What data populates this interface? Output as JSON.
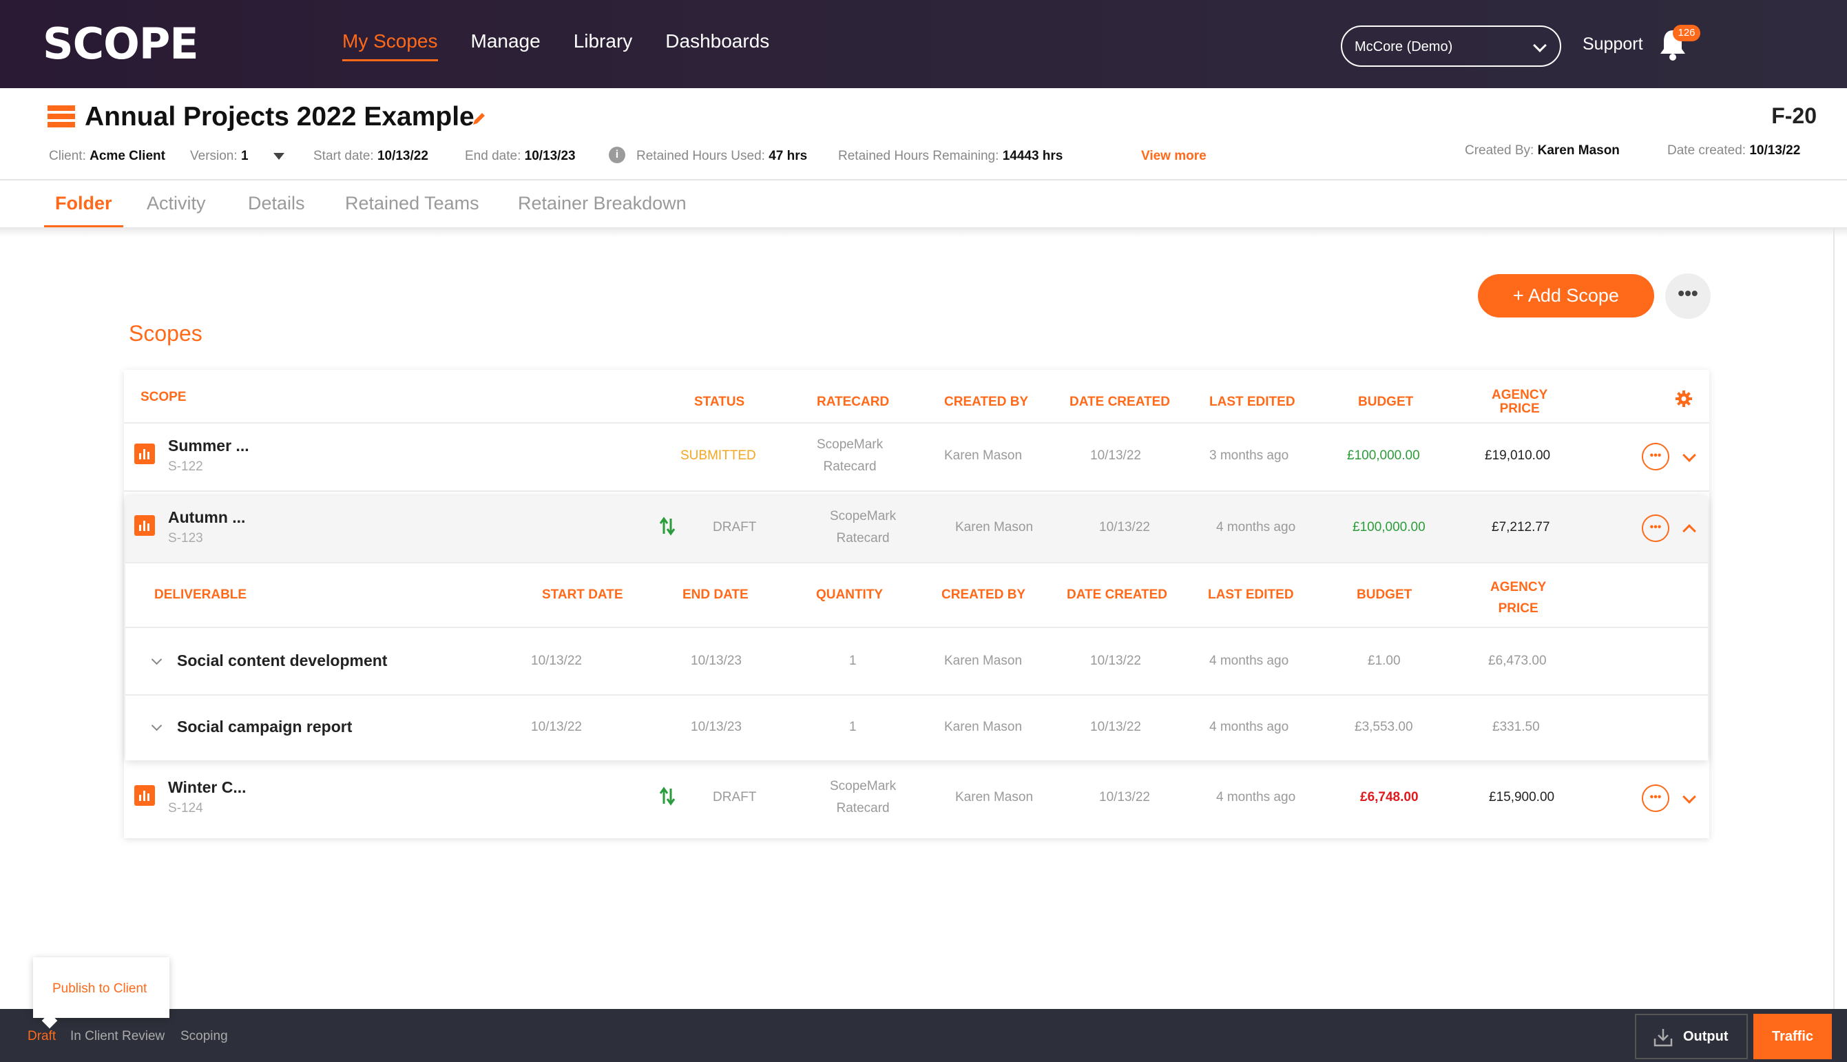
{
  "nav": {
    "logo": "SCOPE",
    "items": [
      "My Scopes",
      "Manage",
      "Library",
      "Dashboards"
    ],
    "account": "McCore (Demo)",
    "support": "Support",
    "notifications": "126",
    "accent_color": "#ff6a1a"
  },
  "project": {
    "title": "Annual Projects 2022 Example",
    "code": "F-20",
    "client_label": "Client:",
    "client": "Acme Client",
    "version_label": "Version:",
    "version": "1",
    "start_label": "Start date:",
    "start": "10/13/22",
    "end_label": "End date:",
    "end": "10/13/23",
    "used_label": "Retained Hours Used:",
    "used": "47 hrs",
    "remaining_label": "Retained Hours Remaining:",
    "remaining": "14443 hrs",
    "view_more": "View more",
    "created_by_label": "Created By:",
    "created_by": "Karen Mason",
    "date_created_label": "Date created:",
    "date_created": "10/13/22"
  },
  "tabs": [
    "Folder",
    "Activity",
    "Details",
    "Retained Teams",
    "Retainer Breakdown"
  ],
  "actions": {
    "add_scope": "+ Add Scope",
    "more": "•••"
  },
  "section_title": "Scopes",
  "table": {
    "headers": {
      "scope": "SCOPE",
      "status": "STATUS",
      "ratecard": "RATECARD",
      "created_by": "CREATED BY",
      "date_created": "DATE CREATED",
      "last_edited": "LAST EDITED",
      "budget": "BUDGET",
      "agency_price_1": "AGENCY",
      "agency_price_2": "PRICE"
    },
    "rows": [
      {
        "name": "Summer ...",
        "code": "S-122",
        "status": "SUBMITTED",
        "ratecard_1": "ScopeMark",
        "ratecard_2": "Ratecard",
        "created_by": "Karen Mason",
        "date_created": "10/13/22",
        "last_edited": "3 months ago",
        "budget": "£100,000.00",
        "agency_price": "£19,010.00"
      },
      {
        "name": "Autumn ...",
        "code": "S-123",
        "status": "DRAFT",
        "ratecard_1": "ScopeMark",
        "ratecard_2": "Ratecard",
        "created_by": "Karen Mason",
        "date_created": "10/13/22",
        "last_edited": "4 months ago",
        "budget": "£100,000.00",
        "agency_price": "£7,212.77"
      },
      {
        "name": "Winter C...",
        "code": "S-124",
        "status": "DRAFT",
        "ratecard_1": "ScopeMark",
        "ratecard_2": "Ratecard",
        "created_by": "Karen Mason",
        "date_created": "10/13/22",
        "last_edited": "4 months ago",
        "budget": "£6,748.00",
        "agency_price": "£15,900.00"
      }
    ],
    "row_action": "•••"
  },
  "deliverables": {
    "headers": {
      "deliverable": "DELIVERABLE",
      "start": "START DATE",
      "end": "END DATE",
      "quantity": "QUANTITY",
      "created_by": "CREATED BY",
      "date_created": "DATE CREATED",
      "last_edited": "LAST EDITED",
      "budget": "BUDGET",
      "agency_price_1": "AGENCY",
      "agency_price_2": "PRICE"
    },
    "rows": [
      {
        "name": "Social content development",
        "start": "10/13/22",
        "end": "10/13/23",
        "quantity": "1",
        "created_by": "Karen Mason",
        "date_created": "10/13/22",
        "last_edited": "4 months ago",
        "budget": "£1.00",
        "agency_price": "£6,473.00"
      },
      {
        "name": "Social campaign report",
        "start": "10/13/22",
        "end": "10/13/23",
        "quantity": "1",
        "created_by": "Karen Mason",
        "date_created": "10/13/22",
        "last_edited": "4 months ago",
        "budget": "£3,553.00",
        "agency_price": "£331.50"
      }
    ]
  },
  "footer": {
    "publish": "Publish to Client",
    "statuses": [
      "Draft",
      "In Client Review",
      "Scoping"
    ],
    "output": "Output",
    "traffic": "Traffic"
  }
}
